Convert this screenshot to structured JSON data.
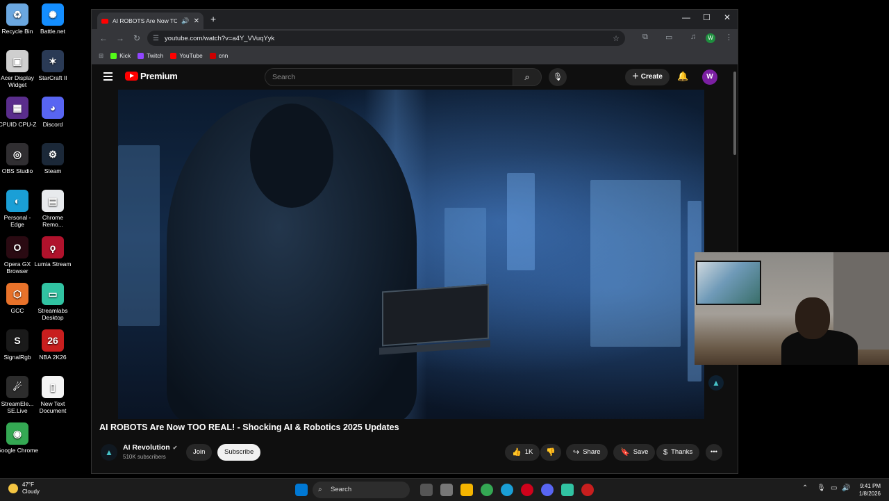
{
  "desktop_icons": [
    {
      "label": "Recycle Bin",
      "icon": "recycle-bin-icon",
      "color": "#6aa7e0",
      "glyph": "♻"
    },
    {
      "label": "Battle.net",
      "icon": "battlenet-icon",
      "color": "#148eff",
      "glyph": "✺"
    },
    {
      "label": "Acer Display Widget",
      "icon": "acer-display-icon",
      "color": "#cfcfcf",
      "glyph": "▣"
    },
    {
      "label": "StarCraft II",
      "icon": "starcraft-icon",
      "color": "#2a3a55",
      "glyph": "✶"
    },
    {
      "label": "CPUID CPU-Z",
      "icon": "cpuz-icon",
      "color": "#5a2d8c",
      "glyph": "▦"
    },
    {
      "label": "Discord",
      "icon": "discord-icon",
      "color": "#5865f2",
      "glyph": "◕"
    },
    {
      "label": "OBS Studio",
      "icon": "obs-icon",
      "color": "#302e31",
      "glyph": "◎"
    },
    {
      "label": "Steam",
      "icon": "steam-icon",
      "color": "#1b2838",
      "glyph": "⚙"
    },
    {
      "label": "Personal - Edge",
      "icon": "edge-icon",
      "color": "#1a9fd6",
      "glyph": "◐"
    },
    {
      "label": "Chrome Remo...",
      "icon": "chrome-remote-icon",
      "color": "#e8eaed",
      "glyph": "▤"
    },
    {
      "label": "Opera GX Browser",
      "icon": "opera-gx-icon",
      "color": "#2a0a12",
      "glyph": "O"
    },
    {
      "label": "Lumia Stream",
      "icon": "lumia-icon",
      "color": "#b0122c",
      "glyph": "ϙ"
    },
    {
      "label": "GCC",
      "icon": "gcc-icon",
      "color": "#e8722a",
      "glyph": "⬡"
    },
    {
      "label": "Streamlabs Desktop",
      "icon": "streamlabs-icon",
      "color": "#31c3a2",
      "glyph": "▭"
    },
    {
      "label": "SignalRgb",
      "icon": "signalrgb-icon",
      "color": "#1a1a1a",
      "glyph": "S"
    },
    {
      "label": "NBA 2K26",
      "icon": "nba2k-icon",
      "color": "#c81e1e",
      "glyph": "26"
    },
    {
      "label": "StreamEle... SE.Live",
      "icon": "streamelements-icon",
      "color": "#2c2c2c",
      "glyph": "☄"
    },
    {
      "label": "New Text Document",
      "icon": "text-document-icon",
      "color": "#f4f4f4",
      "glyph": "▯"
    },
    {
      "label": "Google Chrome",
      "icon": "chrome-icon",
      "color": "#34a853",
      "glyph": "◉"
    }
  ],
  "browser": {
    "tab_title": "AI ROBOTS Are Now TOO R",
    "url": "youtube.com/watch?v=a4Y_VVuqYyk",
    "bookmarks": [
      {
        "label": "Kick",
        "color": "#53fc18"
      },
      {
        "label": "Twitch",
        "color": "#9146ff"
      },
      {
        "label": "YouTube",
        "color": "#ff0000"
      },
      {
        "label": "cnn",
        "color": "#cc0000"
      }
    ],
    "profile_initial": "W"
  },
  "youtube": {
    "logo_text": "Premium",
    "search_placeholder": "Search",
    "create_label": "Create",
    "avatar_initial": "W",
    "video_title": "AI ROBOTS Are Now TOO REAL! - Shocking AI & Robotics 2025 Updates",
    "channel_name": "AI Revolution",
    "subscribers": "510K subscribers",
    "join_label": "Join",
    "subscribe_label": "Subscribe",
    "likes": "1K",
    "share_label": "Share",
    "save_label": "Save",
    "thanks_label": "Thanks"
  },
  "taskbar": {
    "temperature": "47°F",
    "weather": "Cloudy",
    "search_label": "Search",
    "time": "9:41 PM",
    "date": "1/8/2026"
  }
}
